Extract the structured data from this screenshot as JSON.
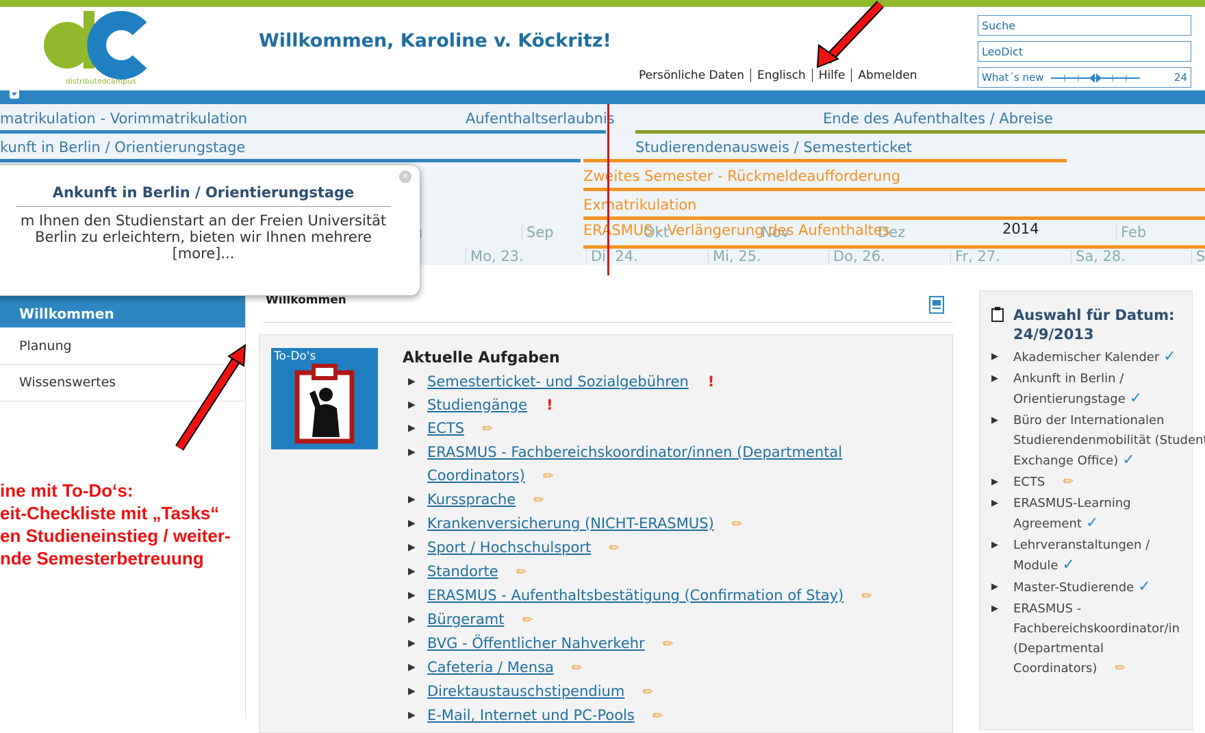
{
  "header": {
    "logo_text": "distributedcampus",
    "welcome": "Willkommen, Karoline v. Köckritz!",
    "links": [
      "Persönliche Daten",
      "Englisch",
      "Hilfe",
      "Abmelden"
    ],
    "search_value": "Suche",
    "leodict_value": "LeoDict",
    "whats_new_label": "What´s new",
    "whats_new_count": "24"
  },
  "timeline": {
    "rows": [
      {
        "label": "matrikulation - Vorimmatrikulation",
        "color": "#3a79a8"
      },
      {
        "label": "Aufenthaltserlaubnis",
        "color": "#3a79a8"
      },
      {
        "label": "Ende des Aufenthaltes / Abreise",
        "color": "#3a79a8"
      },
      {
        "label": "kunft in Berlin / Orientierungstage",
        "color": "#3a79a8"
      },
      {
        "label": "Studierendenausweis / Semesterticket",
        "color": "#3a79a8"
      },
      {
        "label": "Zweites Semester - Rückmeldeaufforderung",
        "color": "#f29322"
      },
      {
        "label": "Exmatrikulation",
        "color": "#f29322"
      },
      {
        "label": "ERASMUS - Verlängerung des Aufenthaltes",
        "color": "#f29322"
      }
    ],
    "months": [
      "g",
      "Sep",
      "Okt",
      "Nov",
      "Dez",
      "2014",
      "Feb"
    ],
    "days": [
      "Mo, 23.",
      "Di, 24.",
      "Mi, 25.",
      "Do, 26.",
      "Fr, 27.",
      "Sa, 28.",
      "S"
    ]
  },
  "popup": {
    "title": "Ankunft in Berlin / Orientierungstage",
    "line1": "m Ihnen den Studienstart an der Freien Universität",
    "line2": "Berlin zu erleichtern, bieten wir Ihnen mehrere",
    "more": "[more]..."
  },
  "sidebar": {
    "items": [
      "Willkommen",
      "Planung",
      "Wissenswertes"
    ]
  },
  "main": {
    "title": "Willkommen",
    "todo_label": "To-Do's",
    "tasks_title": "Aktuelle Aufgaben",
    "tasks": [
      {
        "label": "Semesterticket- und Sozialgebühren",
        "mark": "!"
      },
      {
        "label": "Studiengänge",
        "mark": "!"
      },
      {
        "label": "ECTS",
        "mark": "pencil"
      },
      {
        "label": "ERASMUS - Fachbereichskoordinator/innen (Departmental Coordinators)",
        "mark": "pencil"
      },
      {
        "label": "Kurssprache",
        "mark": "pencil"
      },
      {
        "label": "Krankenversicherung (NICHT-ERASMUS)",
        "mark": "pencil"
      },
      {
        "label": "Sport / Hochschulsport",
        "mark": "pencil"
      },
      {
        "label": "Standorte",
        "mark": "pencil"
      },
      {
        "label": "ERASMUS - Aufenthaltsbestätigung (Confirmation of Stay)",
        "mark": "pencil"
      },
      {
        "label": "Bürgeramt",
        "mark": "pencil"
      },
      {
        "label": "BVG - Öffentlicher Nahverkehr",
        "mark": "pencil"
      },
      {
        "label": "Cafeteria / Mensa",
        "mark": "pencil"
      },
      {
        "label": "Direktaustauschstipendium",
        "mark": "pencil"
      },
      {
        "label": "E-Mail, Internet und PC-Pools",
        "mark": "pencil"
      }
    ]
  },
  "right_panel": {
    "title": "Auswahl für Datum: 24/9/2013",
    "items": [
      {
        "label": "Akademischer Kalender",
        "mark": "check"
      },
      {
        "label": "Ankunft in Berlin / Orientierungstage",
        "mark": "check"
      },
      {
        "label": "Büro der Internationalen Studierendenmobilität (Student Exchange Office)",
        "mark": "check"
      },
      {
        "label": "ECTS",
        "mark": "pencil"
      },
      {
        "label": "ERASMUS-Learning Agreement",
        "mark": "check"
      },
      {
        "label": "Lehrveranstaltungen / Module",
        "mark": "check"
      },
      {
        "label": "Master-Studierende",
        "mark": "check"
      },
      {
        "label": "ERASMUS - Fachbereichskoordinator/in (Departmental Coordinators)",
        "mark": "pencil"
      }
    ]
  },
  "annotation": {
    "lines": [
      "ine mit To-Do‘s:",
      "eit-Checkliste mit „Tasks“",
      "en Studieneinstieg / weiter-",
      "nde Semesterbetreuung"
    ],
    "color": "#ee1111"
  }
}
